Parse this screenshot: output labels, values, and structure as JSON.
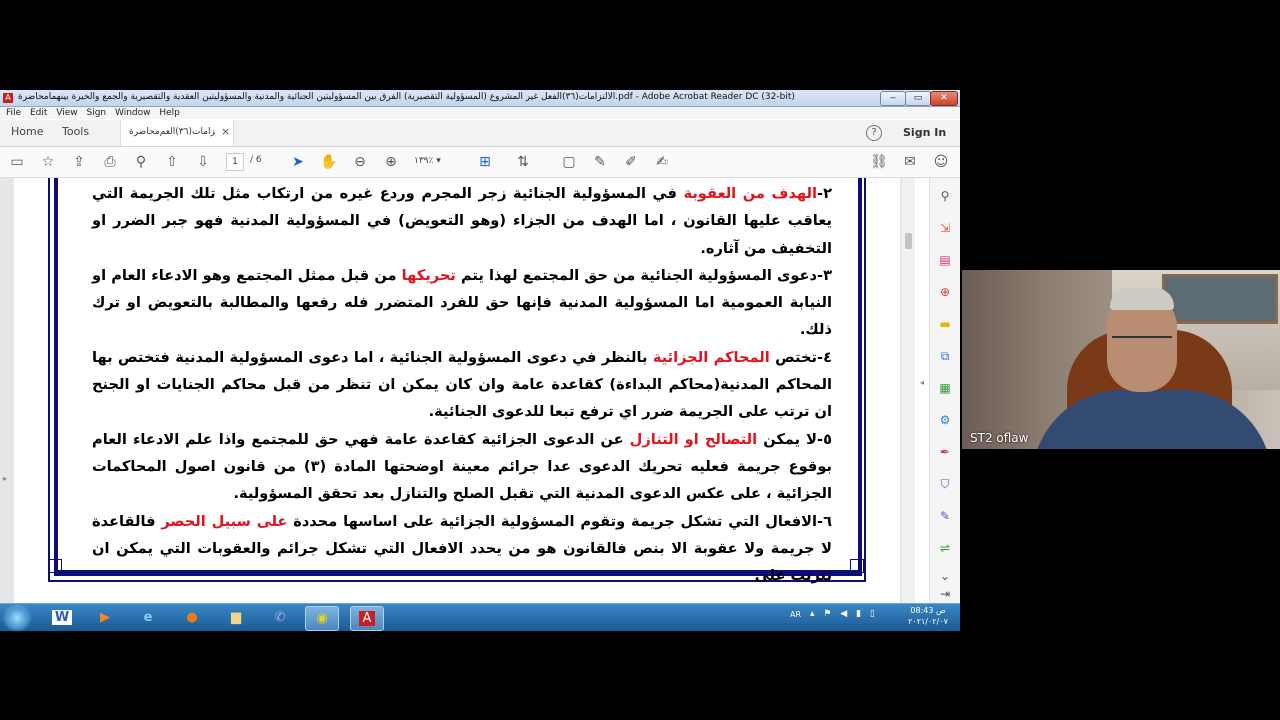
{
  "window": {
    "title": "محاضرة‎الالتزامات(٣٦)الفعل غير المشروع (المسؤولية التقصيرية) الفرق بين المسؤوليتين الجنائية والمدنية والمسؤوليتين العقدية والتقصيرية والجمع والخيرة بينهما.pdf - Adobe Acrobat Reader DC (32-bit)",
    "app_icon": "pdf-icon",
    "minimize": "‒",
    "maximize": "▭",
    "close": "✕"
  },
  "menu": [
    "File",
    "Edit",
    "View",
    "Sign",
    "Window",
    "Help"
  ],
  "tabs": {
    "home": "Home",
    "tools": "Tools",
    "doc": "محاضرة‎الالتزامات(٣٦)العم...",
    "doc_close": "×",
    "help": "?",
    "sign_in": "Sign In"
  },
  "toolbar": {
    "page_current": "1",
    "page_total": "/ 6",
    "zoom": "١٣٩٪"
  },
  "document": {
    "paragraphs": [
      [
        {
          "t": "٢-",
          "c": "b"
        },
        {
          "t": "الهدف من العقوبة",
          "c": "r"
        },
        {
          "t": " في المسؤولية الجنائية زجر المجرم وردع غيره من ارتكاب مثل تلك الجريمة التي يعاقب عليها القانون ، اما الهدف من الجزاء (وهو التعويض) في المسؤولية المدنية فهو جبر الضرر او التخفيف من آثاره.",
          "c": "b"
        }
      ],
      [
        {
          "t": "٣-دعوى المسؤولية الجنائية من حق المجتمع لهذا يتم ",
          "c": "b"
        },
        {
          "t": "تحريكها",
          "c": "r"
        },
        {
          "t": " من قبل ممثل المجتمع وهو الادعاء العام او النيابة العمومية اما المسؤولية المدنية فإنها حق للفرد المتضرر فله رفعها والمطالبة بالتعويض او ترك ذلك.",
          "c": "b"
        }
      ],
      [
        {
          "t": "٤-تختص ",
          "c": "b"
        },
        {
          "t": "المحاكم الجزائية",
          "c": "r"
        },
        {
          "t": " بالنظر في دعوى المسؤولية الجنائية ، اما دعوى المسؤولية المدنية فتختص بها المحاكم المدنية(محاكم البداءة) كقاعدة عامة وان كان يمكن ان تنظر من قبل محاكم الجنايات او الجنح ان ترتب على الجريمة ضرر اي ترفع تبعا للدعوى الجنائية.",
          "c": "b"
        }
      ],
      [
        {
          "t": "٥-لا يمكن ",
          "c": "b"
        },
        {
          "t": "التصالح او التنازل",
          "c": "r"
        },
        {
          "t": " عن الدعوى الجزائية كقاعدة عامة فهي حق للمجتمع واذا علم الادعاء العام بوقوع جريمة فعليه تحريك الدعوى عدا جرائم معينة اوضحتها المادة (٣) من قانون اصول المحاكمات الجزائية ، على عكس الدعوى المدنية التي تقبل الصلح والتنازل بعد تحقق المسؤولية.",
          "c": "b"
        }
      ],
      [
        {
          "t": "٦-الافعال التي تشكل جريمة وتقوم المسؤولية الجزائية على اساسها محددة ",
          "c": "b"
        },
        {
          "t": "على سبيل الحصر",
          "c": "r"
        },
        {
          "t": " فالقاعدة لا جريمة ولا عقوبة الا بنص فالقانون هو من يحدد الافعال التي تشكل جرائم والعقوبات التي يمكن ان تترتب على",
          "c": "b"
        }
      ]
    ]
  },
  "taskbar": {
    "apps": [
      "word-icon",
      "media-player-icon",
      "ie-icon",
      "firefox-icon",
      "folder-icon",
      "viber-icon",
      "chrome-icon",
      "acrobat-icon"
    ],
    "lang": "AR",
    "time": "ص 08:43",
    "date": "٢٠٢١/٠٢/٠٧"
  },
  "webcam": {
    "label": "ST2 oflaw"
  },
  "colors": {
    "frame": "#0d0d7a",
    "highlight": "#e0141e",
    "taskbar": "#1b5b95"
  }
}
